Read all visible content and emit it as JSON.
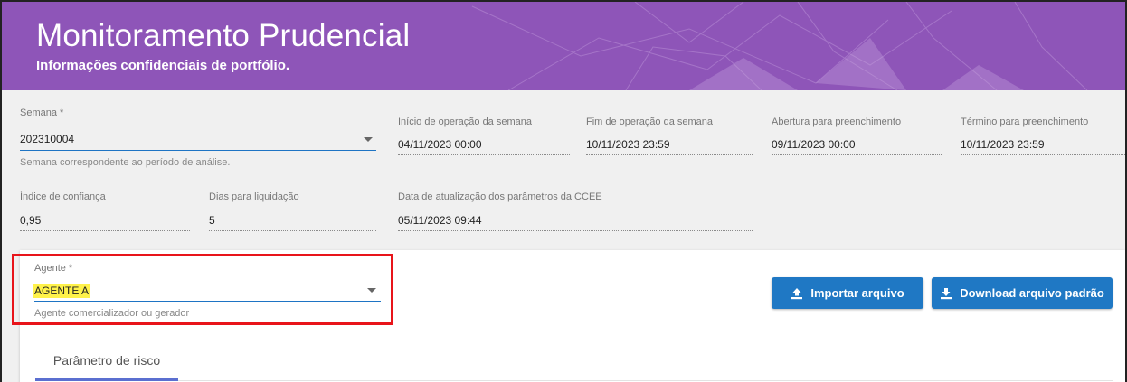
{
  "header": {
    "title": "Monitoramento Prudencial",
    "subtitle": "Informações confidenciais de portfólio."
  },
  "semana": {
    "label": "Semana *",
    "value": "202310004",
    "hint": "Semana correspondente ao período de análise."
  },
  "inicio_operacao": {
    "label": "Início de operação da semana",
    "value": "04/11/2023 00:00"
  },
  "fim_operacao": {
    "label": "Fim de operação da semana",
    "value": "10/11/2023 23:59"
  },
  "abertura_preenchimento": {
    "label": "Abertura para preenchimento",
    "value": "09/11/2023 00:00"
  },
  "termino_preenchimento": {
    "label": "Término para preenchimento",
    "value": "10/11/2023 23:59"
  },
  "indice_confianca": {
    "label": "Índice de confiança",
    "value": "0,95"
  },
  "dias_liquidacao": {
    "label": "Dias para liquidação",
    "value": "5"
  },
  "data_atualizacao": {
    "label": "Data de atualização dos parâmetros da CCEE",
    "value": "05/11/2023 09:44"
  },
  "agente": {
    "label": "Agente *",
    "value": "AGENTE A",
    "hint": "Agente comercializador ou gerador"
  },
  "buttons": {
    "importar": "Importar arquivo",
    "download": "Download arquivo padrão"
  },
  "tabs": [
    {
      "label": "Parâmetro de risco",
      "active": true
    }
  ],
  "colors": {
    "header_bg": "#8e55b8",
    "button_bg": "#1f78c4",
    "highlight": "#fff24a",
    "annotation_border": "#e8141a",
    "tab_accent": "#5b6fd0"
  },
  "icons": {
    "importar": "upload-icon",
    "download": "download-icon",
    "select_caret": "caret-down-icon"
  }
}
